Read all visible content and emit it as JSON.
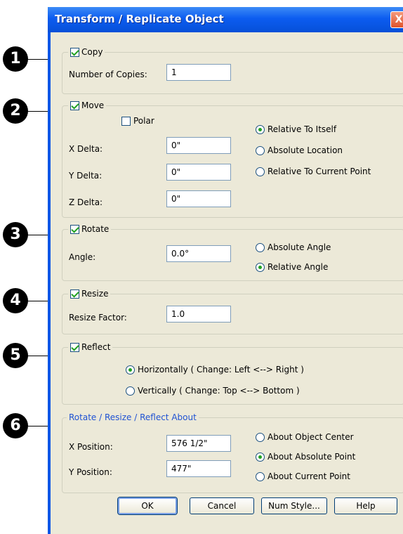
{
  "dialog": {
    "title": "Transform / Replicate Object",
    "close_glyph": "X"
  },
  "callouts": [
    "1",
    "2",
    "3",
    "4",
    "5",
    "6"
  ],
  "copy": {
    "label": "Copy",
    "checked": true,
    "num_copies_label": "Number of Copies:",
    "num_copies_value": "1"
  },
  "move": {
    "label": "Move",
    "checked": true,
    "polar_label": "Polar",
    "polar_checked": false,
    "x_label": "X Delta:",
    "x_value": "0\"",
    "y_label": "Y Delta:",
    "y_value": "0\"",
    "z_label": "Z Delta:",
    "z_value": "0\"",
    "options": [
      "Relative To Itself",
      "Absolute Location",
      "Relative To Current Point"
    ],
    "selected": "Relative To Itself"
  },
  "rotate": {
    "label": "Rotate",
    "checked": true,
    "angle_label": "Angle:",
    "angle_value": "0.0°",
    "options": [
      "Absolute Angle",
      "Relative Angle"
    ],
    "selected": "Relative Angle"
  },
  "resize": {
    "label": "Resize",
    "checked": true,
    "factor_label": "Resize Factor:",
    "factor_value": "1.0"
  },
  "reflect": {
    "label": "Reflect",
    "checked": true,
    "options": [
      "Horizontally ( Change: Left <--> Right )",
      "Vertically ( Change: Top <--> Bottom )"
    ],
    "selected": "Horizontally ( Change: Left <--> Right )"
  },
  "about": {
    "label": "Rotate / Resize / Reflect About",
    "x_label": "X Position:",
    "x_value": "576 1/2\"",
    "y_label": "Y Position:",
    "y_value": "477\"",
    "options": [
      "About Object Center",
      "About Absolute Point",
      "About Current Point"
    ],
    "selected": "About Absolute Point"
  },
  "buttons": {
    "ok": "OK",
    "cancel": "Cancel",
    "num_style": "Num Style...",
    "help": "Help"
  },
  "colors": {
    "title_bar": "#0c5cf0",
    "dialog_bg": "#ece9d8",
    "check_green": "#21a121",
    "group_title_blue": "#1f52d3"
  }
}
